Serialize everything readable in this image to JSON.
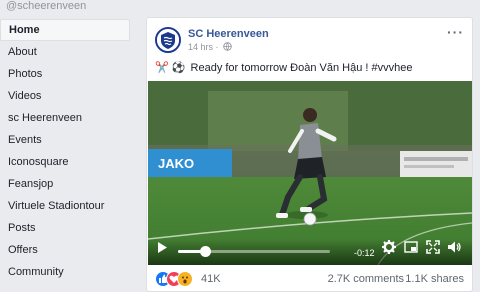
{
  "page_handle": "@scheerenveen",
  "sidebar": {
    "items": [
      {
        "label": "Home",
        "active": true
      },
      {
        "label": "About"
      },
      {
        "label": "Photos"
      },
      {
        "label": "Videos"
      },
      {
        "label": "sc Heerenveen"
      },
      {
        "label": "Events"
      },
      {
        "label": "Iconosquare"
      },
      {
        "label": "Feansjop"
      },
      {
        "label": "Virtuele Stadiontour"
      },
      {
        "label": "Posts"
      },
      {
        "label": "Offers"
      },
      {
        "label": "Community"
      }
    ]
  },
  "post": {
    "page_name": "SC Heerenveen",
    "time": "14 hrs",
    "privacy_icon": "globe-icon",
    "caption_emojis": "✂️ ⚽",
    "caption_text": "Ready for tomorrow Đoàn Văn Hậu ! #vvvhee",
    "video": {
      "banner_text": "JAKO",
      "remaining_time": "-0:12",
      "progress": 0.18
    },
    "reaction_count": "41K",
    "comments": "2.7K comments",
    "shares": "1.1K shares"
  },
  "colors": {
    "link": "#385898",
    "background": "#e9ebee",
    "like": "#1877f2",
    "love": "#f33e58",
    "wow": "#f7b125"
  }
}
